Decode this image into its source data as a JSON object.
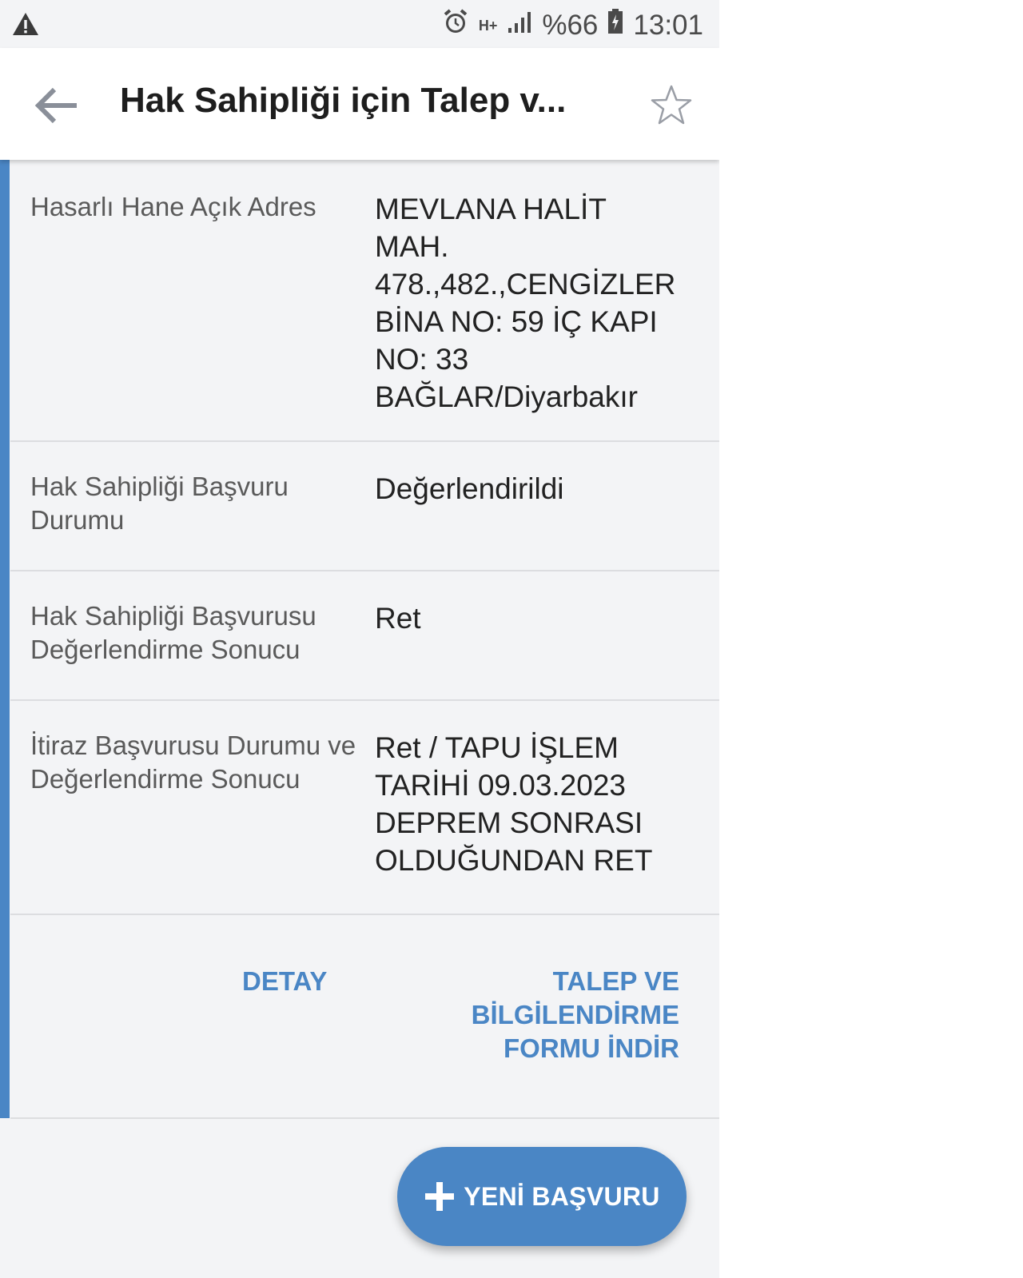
{
  "status_bar": {
    "network": "H+",
    "battery_percent": "%66",
    "time": "13:01",
    "icons": [
      "warning-icon",
      "alarm-icon",
      "signal-icon",
      "battery-icon"
    ]
  },
  "app_bar": {
    "title": "Hak Sahipliği için Talep v...",
    "back_icon": "arrow-left-icon",
    "favorite_icon": "star-outline-icon"
  },
  "details": [
    {
      "label": "Hasarlı Hane Açık Adres",
      "value": "MEVLANA HALİT\nMAH.\n478.,482.,CENGİZLER\nBİNA NO: 59 İÇ KAPI\nNO: 33\nBAĞLAR/Diyarbakır"
    },
    {
      "label": "Hak Sahipliği Başvuru Durumu",
      "value": "Değerlendirildi"
    },
    {
      "label": "Hak Sahipliği Başvurusu Değerlendirme Sonucu",
      "value": "Ret"
    },
    {
      "label": "İtiraz Başvurusu Durumu ve Değerlendirme Sonucu",
      "value": "Ret / TAPU İŞLEM\nTARİHİ 09.03.2023\nDEPREM SONRASI\nOLDUĞUNDAN RET"
    }
  ],
  "actions": {
    "detail_label": "DETAY",
    "download_label": "TALEP VE\nBİLGİLENDİRME\nFORMU İNDİR"
  },
  "fab": {
    "icon": "plus-icon",
    "label": "YENİ BAŞVURU"
  },
  "colors": {
    "accent": "#4a86c5",
    "background": "#f3f4f6",
    "divider": "#dcdde0"
  }
}
